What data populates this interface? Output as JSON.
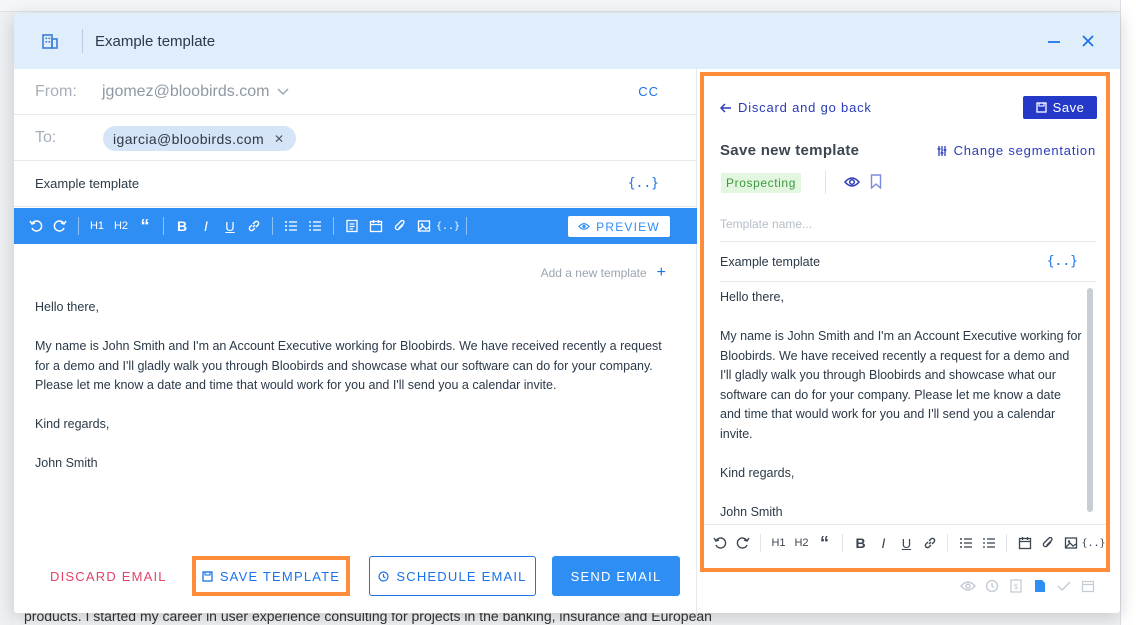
{
  "modal": {
    "title": "Example template"
  },
  "composer": {
    "from_label": "From:",
    "from_value": "jgomez@bloobirds.com",
    "cc_label": "CC",
    "to_label": "To:",
    "to_chip": "igarcia@bloobirds.com",
    "subject": "Example template",
    "preview_label": "PREVIEW",
    "add_template_label": "Add a new template",
    "body": [
      "Hello there,",
      "My name is John Smith and I'm an Account Executive working for Bloobirds. We have received recently a request for a demo and I'll gladly walk you through Bloobirds and showcase what our software can do for your company. Please let me know a date and time that would work for you and I'll send you a calendar invite.",
      "Kind regards,",
      "John Smith"
    ],
    "discard_label": "DISCARD EMAIL",
    "save_template_label": "SAVE TEMPLATE",
    "schedule_label": "SCHEDULE EMAIL",
    "send_label": "SEND EMAIL"
  },
  "template_panel": {
    "back_label": "Discard and go back",
    "save_label": "Save",
    "title": "Save new template",
    "change_segmentation_label": "Change segmentation",
    "tag": "Prospecting",
    "name_placeholder": "Template name...",
    "subject": "Example template",
    "body": [
      "Hello there,",
      "My name is John Smith and I'm an Account Executive working for Bloobirds. We have received recently a request for a demo and I'll gladly walk you through Bloobirds and showcase what our software can do for your company. Please let me know a date and time that would work for you and I'll send you a calendar invite.",
      "Kind regards,",
      "John Smith"
    ]
  },
  "background": {
    "bottom_text": "products. I started my career in user experience consulting for projects in the banking, insurance and European"
  },
  "toolbar": {
    "h1": "H1",
    "h2": "H2",
    "quote": "“",
    "bold": "B",
    "italic": "I",
    "underline": "U",
    "variable": "{..}"
  },
  "colors": {
    "primary": "#2f8ef4",
    "dark_blue": "#2439c8",
    "highlight": "#ff8c3b",
    "danger": "#e0446a",
    "tag_bg": "#e2f6e0",
    "tag_text": "#3d9a40"
  },
  "icons": [
    "building-icon",
    "minimize-icon",
    "close-icon",
    "chevron-down-icon",
    "undo-icon",
    "redo-icon",
    "link-icon",
    "bullet-list-icon",
    "numbered-list-icon",
    "template-icon",
    "calendar-icon",
    "attachment-icon",
    "image-icon",
    "eye-icon",
    "bookmark-icon",
    "save-icon",
    "clock-icon",
    "arrow-left-icon",
    "sliders-icon"
  ]
}
